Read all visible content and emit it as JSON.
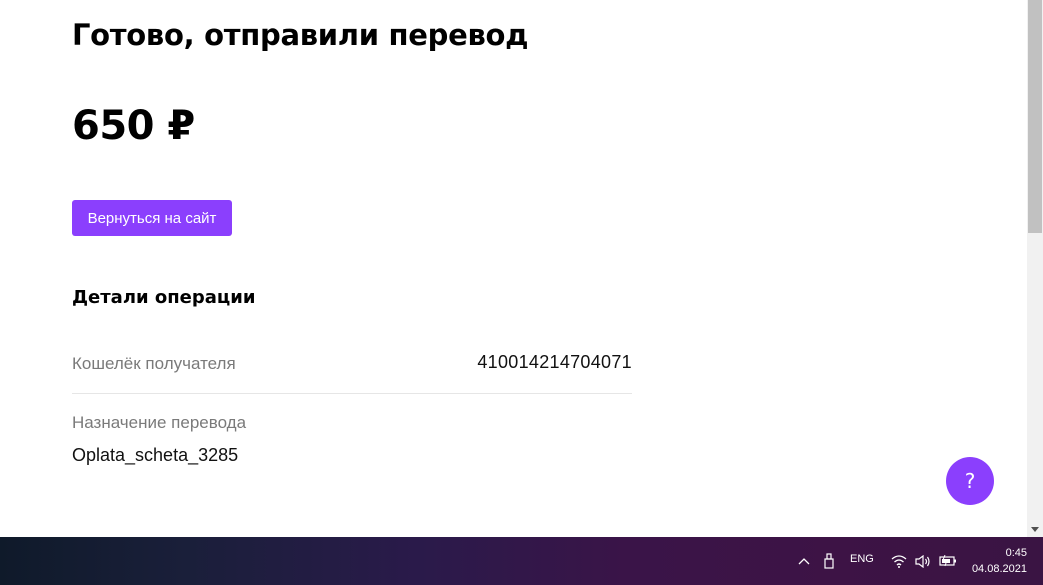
{
  "page": {
    "title": "Готово, отправили перевод",
    "amount": "650 ₽",
    "back_button_label": "Вернуться на сайт",
    "details_heading": "Детали операции",
    "wallet_label": "Кошелёк получателя",
    "wallet_value": "410014214704071",
    "purpose_label": "Назначение перевода",
    "purpose_value": "Oplata_scheta_3285",
    "help_button_label": "?"
  },
  "taskbar": {
    "language": "ENG",
    "time": "0:45",
    "date": "04.08.2021",
    "icons": [
      "chevron-up-icon",
      "usb-drive-icon",
      "wifi-icon",
      "volume-icon",
      "battery-icon"
    ]
  },
  "colors": {
    "accent": "#8b3ffd",
    "muted_text": "#7a7a7a",
    "divider": "#e6e6e6"
  }
}
